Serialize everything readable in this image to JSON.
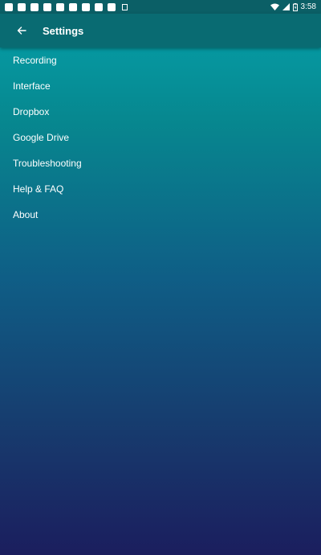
{
  "status_bar": {
    "time": "3:58",
    "notification_count": 9,
    "icons": [
      "wifi-icon",
      "signal-icon",
      "battery-icon"
    ]
  },
  "app_bar": {
    "title": "Settings",
    "back_icon": "arrow-left-icon"
  },
  "menu": {
    "items": [
      {
        "label": "Recording"
      },
      {
        "label": "Interface"
      },
      {
        "label": "Dropbox"
      },
      {
        "label": "Google Drive"
      },
      {
        "label": "Troubleshooting"
      },
      {
        "label": "Help & FAQ"
      },
      {
        "label": "About"
      }
    ]
  },
  "colors": {
    "status_bar_bg": "#0b5f66",
    "app_bar_bg": "#096b72",
    "gradient_top": "#04a2ab",
    "gradient_bottom": "#1b1e5e",
    "text": "#ffffff"
  }
}
